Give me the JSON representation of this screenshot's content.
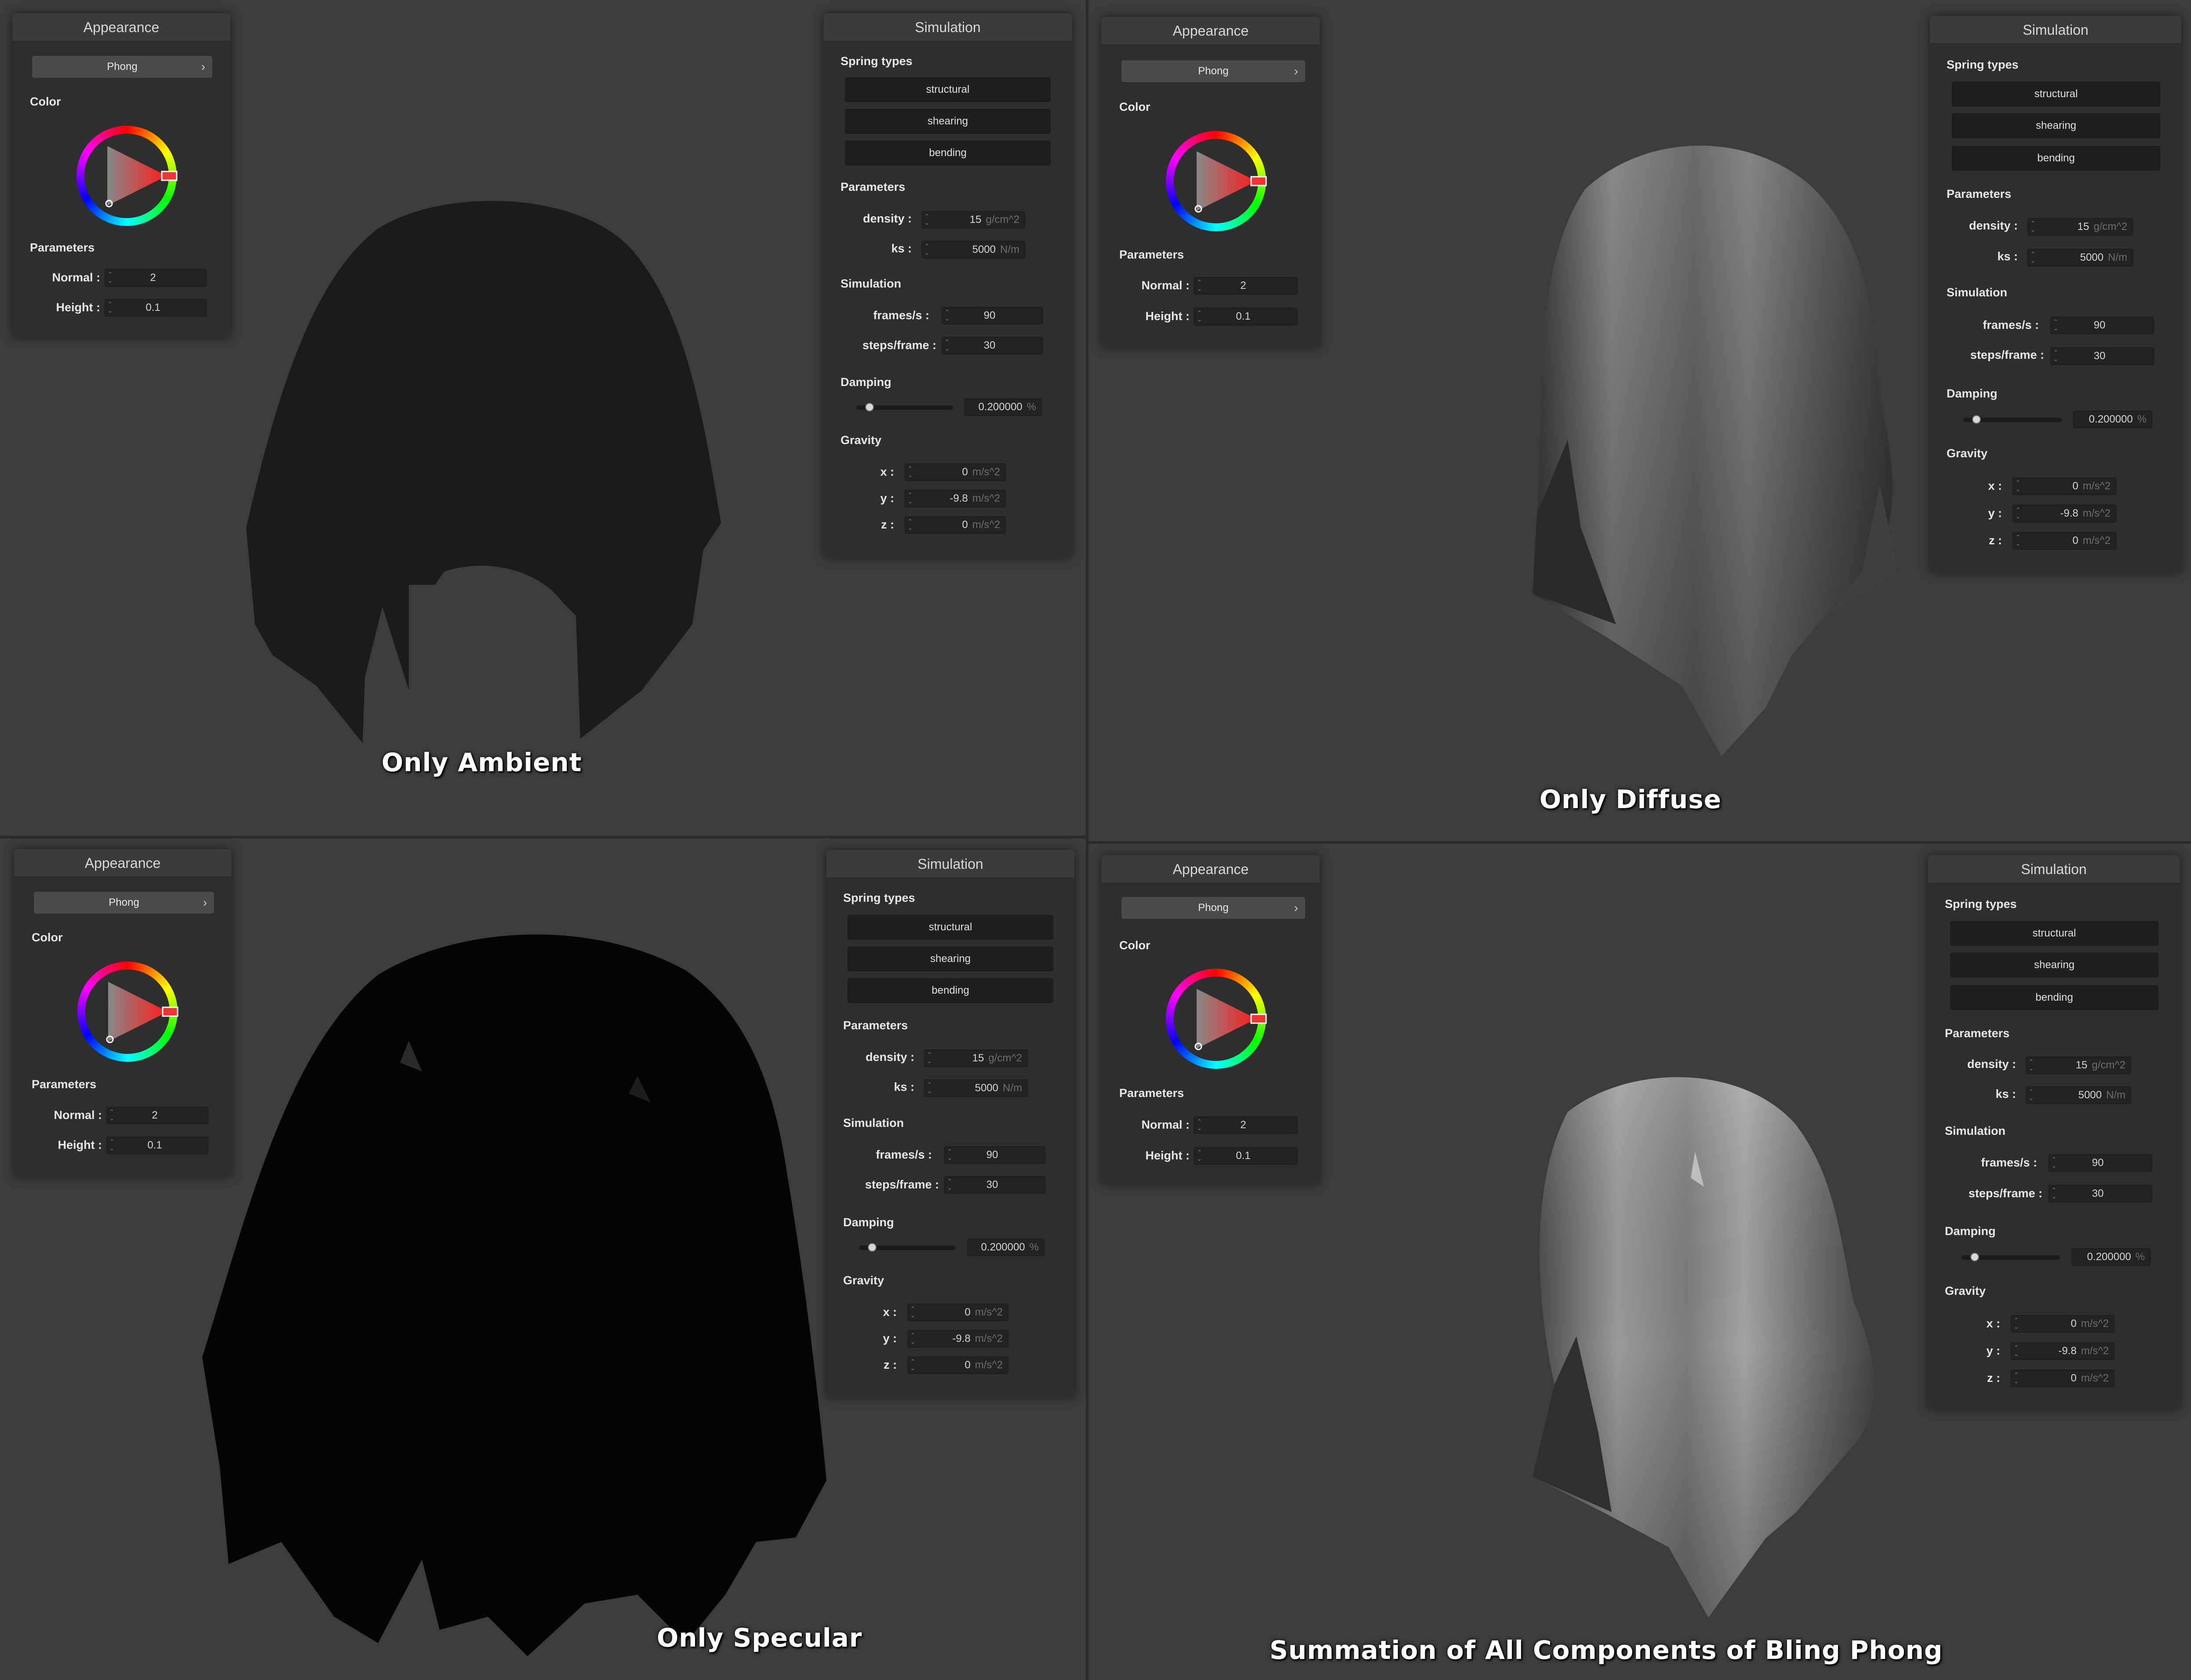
{
  "views": [
    {
      "caption": "Only Ambient",
      "appearance": {
        "title": "Appearance",
        "shader": "Phong",
        "shader_arrow": "›",
        "color_label": "Color",
        "params_label": "Parameters",
        "normal_label": "Normal :",
        "normal_value": "2",
        "height_label": "Height :",
        "height_value": "0.1"
      },
      "simulation": {
        "title": "Simulation",
        "spring_label": "Spring types",
        "structural": "structural",
        "shearing": "shearing",
        "bending": "bending",
        "params_label": "Parameters",
        "density_label": "density :",
        "density_value": "15",
        "density_unit": "g/cm^2",
        "ks_label": "ks :",
        "ks_value": "5000",
        "ks_unit": "N/m",
        "sim_label": "Simulation",
        "fps_label": "frames/s :",
        "fps_value": "90",
        "steps_label": "steps/frame :",
        "steps_value": "30",
        "damping_label": "Damping",
        "damping_value": "0.200000",
        "damping_unit": "%",
        "gravity_label": "Gravity",
        "gx_label": "x :",
        "gx_value": "0",
        "gy_label": "y :",
        "gy_value": "-9.8",
        "gz_label": "z :",
        "gz_value": "0",
        "g_unit": "m/s^2"
      }
    },
    {
      "caption": "Only Diffuse",
      "appearance": {
        "title": "Appearance",
        "shader": "Phong",
        "shader_arrow": "›",
        "color_label": "Color",
        "params_label": "Parameters",
        "normal_label": "Normal :",
        "normal_value": "2",
        "height_label": "Height :",
        "height_value": "0.1"
      },
      "simulation": {
        "title": "Simulation",
        "spring_label": "Spring types",
        "structural": "structural",
        "shearing": "shearing",
        "bending": "bending",
        "params_label": "Parameters",
        "density_label": "density :",
        "density_value": "15",
        "density_unit": "g/cm^2",
        "ks_label": "ks :",
        "ks_value": "5000",
        "ks_unit": "N/m",
        "sim_label": "Simulation",
        "fps_label": "frames/s :",
        "fps_value": "90",
        "steps_label": "steps/frame :",
        "steps_value": "30",
        "damping_label": "Damping",
        "damping_value": "0.200000",
        "damping_unit": "%",
        "gravity_label": "Gravity",
        "gx_label": "x :",
        "gx_value": "0",
        "gy_label": "y :",
        "gy_value": "-9.8",
        "gz_label": "z :",
        "gz_value": "0",
        "g_unit": "m/s^2"
      }
    },
    {
      "caption": "Only Specular",
      "appearance": {
        "title": "Appearance",
        "shader": "Phong",
        "shader_arrow": "›",
        "color_label": "Color",
        "params_label": "Parameters",
        "normal_label": "Normal :",
        "normal_value": "2",
        "height_label": "Height :",
        "height_value": "0.1"
      },
      "simulation": {
        "title": "Simulation",
        "spring_label": "Spring types",
        "structural": "structural",
        "shearing": "shearing",
        "bending": "bending",
        "params_label": "Parameters",
        "density_label": "density :",
        "density_value": "15",
        "density_unit": "g/cm^2",
        "ks_label": "ks :",
        "ks_value": "5000",
        "ks_unit": "N/m",
        "sim_label": "Simulation",
        "fps_label": "frames/s :",
        "fps_value": "90",
        "steps_label": "steps/frame :",
        "steps_value": "30",
        "damping_label": "Damping",
        "damping_value": "0.200000",
        "damping_unit": "%",
        "gravity_label": "Gravity",
        "gx_label": "x :",
        "gx_value": "0",
        "gy_label": "y :",
        "gy_value": "-9.8",
        "gz_label": "z :",
        "gz_value": "0",
        "g_unit": "m/s^2"
      }
    },
    {
      "caption": "Summation of All Components of Bling Phong",
      "appearance": {
        "title": "Appearance",
        "shader": "Phong",
        "shader_arrow": "›",
        "color_label": "Color",
        "params_label": "Parameters",
        "normal_label": "Normal :",
        "normal_value": "2",
        "height_label": "Height :",
        "height_value": "0.1"
      },
      "simulation": {
        "title": "Simulation",
        "spring_label": "Spring types",
        "structural": "structural",
        "shearing": "shearing",
        "bending": "bending",
        "params_label": "Parameters",
        "density_label": "density :",
        "density_value": "15",
        "density_unit": "g/cm^2",
        "ks_label": "ks :",
        "ks_value": "5000",
        "ks_unit": "N/m",
        "sim_label": "Simulation",
        "fps_label": "frames/s :",
        "fps_value": "90",
        "steps_label": "steps/frame :",
        "steps_value": "30",
        "damping_label": "Damping",
        "damping_value": "0.200000",
        "damping_unit": "%",
        "gravity_label": "Gravity",
        "gx_label": "x :",
        "gx_value": "0",
        "gy_label": "y :",
        "gy_value": "-9.8",
        "gz_label": "z :",
        "gz_value": "0",
        "g_unit": "m/s^2"
      }
    }
  ],
  "colors": {
    "viewport_bg": "#3c3c3c",
    "panel_bg": "#2e2e2e",
    "ambient_cloth": "#1b1b1b",
    "specular_cloth": "#050505",
    "diffuse_cloth": "#7a7a7a"
  },
  "icons": {
    "color_wheel": "hsv-color-wheel-icon",
    "spinner": "up-down-spinner-icon",
    "dropdown": "chevron-right-icon"
  }
}
